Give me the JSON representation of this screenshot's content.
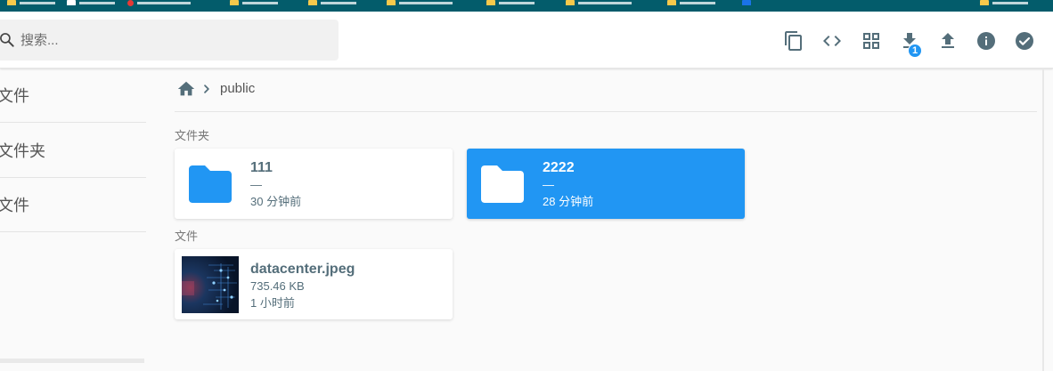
{
  "search": {
    "placeholder": "搜索..."
  },
  "toolbar": {
    "tools": [
      {
        "name": "copy-icon"
      },
      {
        "name": "code-icon"
      },
      {
        "name": "grid-view-icon"
      },
      {
        "name": "download-icon"
      },
      {
        "name": "upload-icon"
      },
      {
        "name": "info-icon"
      },
      {
        "name": "select-check-icon"
      }
    ],
    "download_badge": "1",
    "icon_color": "#546e7a"
  },
  "sidebar": {
    "items": [
      {
        "label": "文件"
      },
      {
        "label": "文件夹"
      },
      {
        "label": "文件"
      }
    ]
  },
  "breadcrumb": {
    "home_icon": "home-icon",
    "path": "public"
  },
  "sections": {
    "folders": "文件夹",
    "files": "文件"
  },
  "folders": [
    {
      "name": "111",
      "size": "—",
      "modified": "30 分钟前",
      "selected": false
    },
    {
      "name": "2222",
      "size": "—",
      "modified": "28 分钟前",
      "selected": true
    }
  ],
  "files": [
    {
      "name": "datacenter.jpeg",
      "size": "735.46 KB",
      "modified": "1 小时前"
    }
  ],
  "colors": {
    "accent": "#2196f3",
    "text": "#546e7a"
  }
}
